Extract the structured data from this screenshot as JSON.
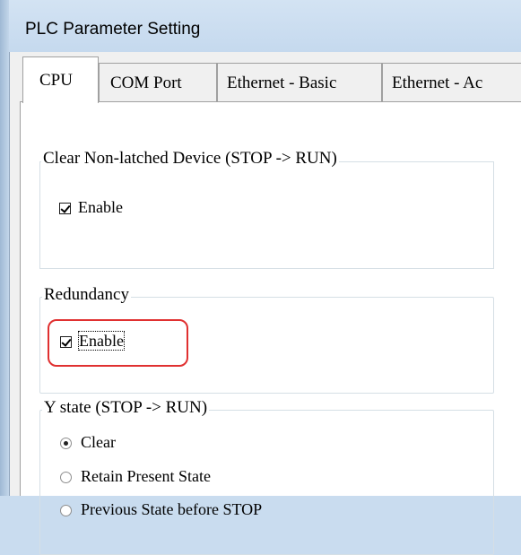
{
  "window": {
    "title": "PLC Parameter Setting"
  },
  "tabs": [
    {
      "label": "CPU",
      "active": true
    },
    {
      "label": "COM Port",
      "active": false
    },
    {
      "label": "Ethernet - Basic",
      "active": false
    },
    {
      "label": "Ethernet - Ac",
      "active": false
    }
  ],
  "groups": {
    "clear_nonlatched": {
      "title": "Clear Non-latched Device (STOP -> RUN)",
      "enable_label": "Enable",
      "enable_checked": true
    },
    "redundancy": {
      "title": "Redundancy",
      "enable_label": "Enable",
      "enable_checked": true,
      "highlight_color": "#e03030"
    },
    "y_state": {
      "title": "Y state (STOP -> RUN)",
      "options": [
        {
          "label": "Clear",
          "selected": true
        },
        {
          "label": "Retain Present State",
          "selected": false
        },
        {
          "label": "Previous State before STOP",
          "selected": false
        }
      ]
    }
  }
}
